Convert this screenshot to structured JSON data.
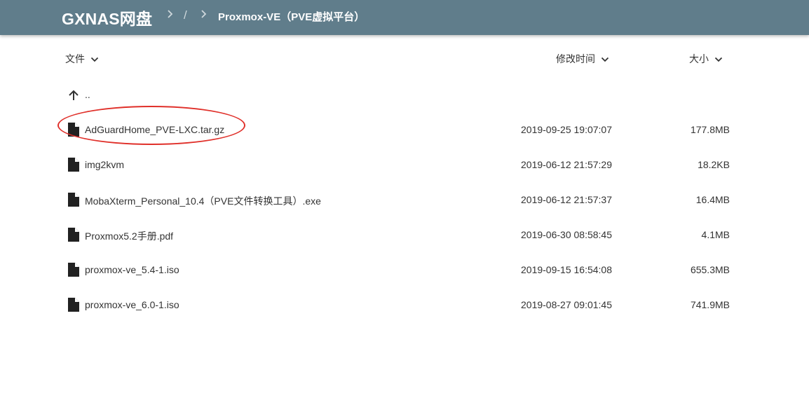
{
  "header": {
    "brand": "GXNAS网盘",
    "breadcrumb_slash": "/",
    "breadcrumb_current": "Proxmox-VE（PVE虚拟平台）"
  },
  "columns": {
    "name": "文件",
    "modified": "修改时间",
    "size": "大小"
  },
  "parent_dir": {
    "label": ".."
  },
  "files": [
    {
      "name": "AdGuardHome_PVE-LXC.tar.gz",
      "modified": "2019-09-25 19:07:07",
      "size": "177.8MB"
    },
    {
      "name": "img2kvm",
      "modified": "2019-06-12 21:57:29",
      "size": "18.2KB"
    },
    {
      "name": "MobaXterm_Personal_10.4（PVE文件转换工具）.exe",
      "modified": "2019-06-12 21:57:37",
      "size": "16.4MB"
    },
    {
      "name": "Proxmox5.2手册.pdf",
      "modified": "2019-06-30 08:58:45",
      "size": "4.1MB"
    },
    {
      "name": "proxmox-ve_5.4-1.iso",
      "modified": "2019-09-15 16:54:08",
      "size": "655.3MB"
    },
    {
      "name": "proxmox-ve_6.0-1.iso",
      "modified": "2019-08-27 09:01:45",
      "size": "741.9MB"
    }
  ],
  "colors": {
    "topbar": "#607d8b",
    "highlight_annotation": "#e0302a"
  }
}
